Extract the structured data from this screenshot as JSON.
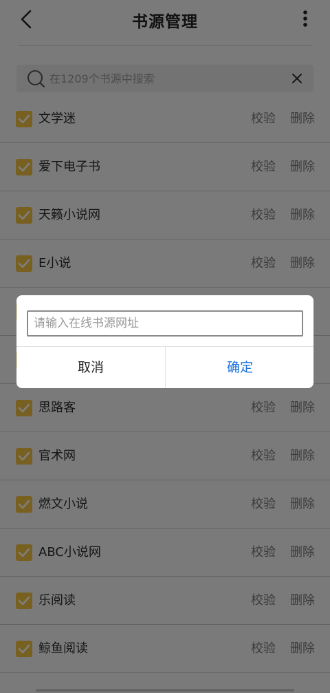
{
  "header": {
    "title": "书源管理"
  },
  "search": {
    "placeholder": "在1209个书源中搜索"
  },
  "list": {
    "items": [
      {
        "name": "文学迷",
        "verify_label": "校验",
        "delete_label": "删除",
        "checked": true
      },
      {
        "name": "爱下电子书",
        "verify_label": "校验",
        "delete_label": "删除",
        "checked": true
      },
      {
        "name": "天籁小说网",
        "verify_label": "校验",
        "delete_label": "删除",
        "checked": true
      },
      {
        "name": "E小说",
        "verify_label": "校验",
        "delete_label": "删除",
        "checked": true
      },
      {
        "name": "",
        "verify_label": "",
        "delete_label": "",
        "checked": true
      },
      {
        "name": "",
        "verify_label": "",
        "delete_label": "",
        "checked": true
      },
      {
        "name": "思路客",
        "verify_label": "校验",
        "delete_label": "删除",
        "checked": true
      },
      {
        "name": "官术网",
        "verify_label": "校验",
        "delete_label": "删除",
        "checked": true
      },
      {
        "name": "燃文小说",
        "verify_label": "校验",
        "delete_label": "删除",
        "checked": true
      },
      {
        "name": "ABC小说网",
        "verify_label": "校验",
        "delete_label": "删除",
        "checked": true
      },
      {
        "name": "乐阅读",
        "verify_label": "校验",
        "delete_label": "删除",
        "checked": true
      },
      {
        "name": "鲸鱼阅读",
        "verify_label": "校验",
        "delete_label": "删除",
        "checked": true
      }
    ]
  },
  "dialog": {
    "input_placeholder": "请输入在线书源网址",
    "input_value": "",
    "cancel_label": "取消",
    "confirm_label": "确定"
  },
  "colors": {
    "checkbox": "#f0c040",
    "confirm": "#1a73d9",
    "overlay": "rgba(0,0,0,0.5)"
  },
  "icons": {
    "back": "chevron-left-icon",
    "more": "more-vertical-icon",
    "search": "search-icon",
    "clear": "close-icon",
    "check": "checkmark-icon"
  }
}
